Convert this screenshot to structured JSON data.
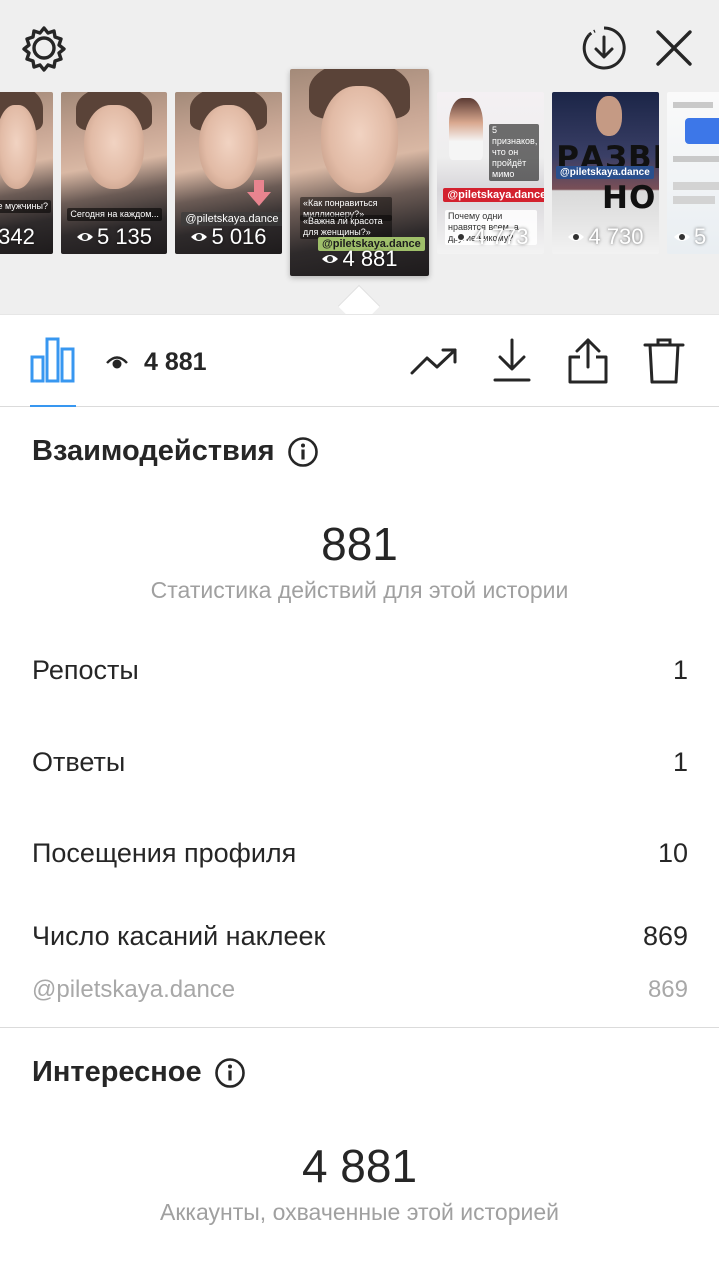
{
  "header": {
    "settings_icon": "gear-icon",
    "download_icon": "download-circle-icon",
    "close_icon": "close-icon"
  },
  "stories": [
    {
      "views": "342",
      "style": "face",
      "caption": "ые мужчины?"
    },
    {
      "views": "5 135",
      "style": "face",
      "caption": "Сегодня на каждом..."
    },
    {
      "views": "5 016",
      "style": "face",
      "tag": "@piletskaya.dance"
    },
    {
      "views": "4 881",
      "style": "face",
      "selected": true,
      "caption1": "«Как понравиться миллионеру?»",
      "caption2": "«Важна ли красота для женщины?»",
      "tag": "@piletskaya.dance"
    },
    {
      "views": "4 773",
      "style": "pink",
      "caption1": "5 признаков, что он пройдёт мимо",
      "tag": "@piletskaya.dance",
      "caption2": "Почему одни нравятся всем, а другие никому?"
    },
    {
      "views": "4 730",
      "style": "night",
      "tag": "@piletskaya.dance",
      "big_word1": "РАЗВЕ",
      "big_word2": "НОГИ"
    },
    {
      "views": "5",
      "style": "chat"
    }
  ],
  "toolbar": {
    "insights_icon": "bar-chart-icon",
    "views_icon": "eye-icon",
    "views_count": "4 881",
    "promote_icon": "trending-up-icon",
    "save_icon": "download-icon",
    "share_icon": "share-icon",
    "delete_icon": "trash-icon"
  },
  "interactions": {
    "title": "Взаимодействия",
    "info_icon": "info-icon",
    "total": "881",
    "total_desc": "Статистика действий для этой истории",
    "rows": [
      {
        "label": "Репосты",
        "value": "1"
      },
      {
        "label": "Ответы",
        "value": "1"
      },
      {
        "label": "Посещения профиля",
        "value": "10"
      },
      {
        "label": "Число касаний наклеек",
        "value": "869"
      }
    ],
    "sticker": {
      "label": "@piletskaya.dance",
      "value": "869"
    }
  },
  "discovery": {
    "title": "Интересное",
    "info_icon": "info-icon",
    "total": "4 881",
    "total_desc": "Аккаунты, охваченные этой историей"
  },
  "colors": {
    "accent": "#3897f0",
    "top_bg": "#efefef",
    "text": "#262626",
    "secondary_text": "#a0a0a0"
  }
}
